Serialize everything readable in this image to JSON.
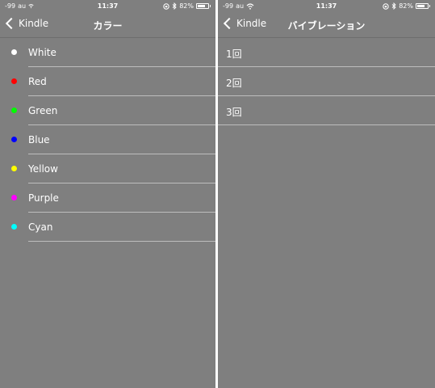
{
  "left": {
    "status": {
      "signal": "-99",
      "carrier": "au",
      "time": "11:37",
      "battery": "82%"
    },
    "nav": {
      "back_label": "Kindle",
      "title": "カラー"
    },
    "colors": [
      {
        "label": "White",
        "color": "#ffffff"
      },
      {
        "label": "Red",
        "color": "#ff0000"
      },
      {
        "label": "Green",
        "color": "#00ff00"
      },
      {
        "label": "Blue",
        "color": "#0000ff"
      },
      {
        "label": "Yellow",
        "color": "#ffff00"
      },
      {
        "label": "Purple",
        "color": "#ff00ff"
      },
      {
        "label": "Cyan",
        "color": "#00ffff"
      }
    ]
  },
  "right": {
    "status": {
      "signal": "-99",
      "carrier": "au",
      "time": "11:37",
      "battery": "82%"
    },
    "nav": {
      "back_label": "Kindle",
      "title": "バイブレーション"
    },
    "options": [
      {
        "label": "1回"
      },
      {
        "label": "2回"
      },
      {
        "label": "3回"
      }
    ]
  },
  "battery_level": 0.82
}
